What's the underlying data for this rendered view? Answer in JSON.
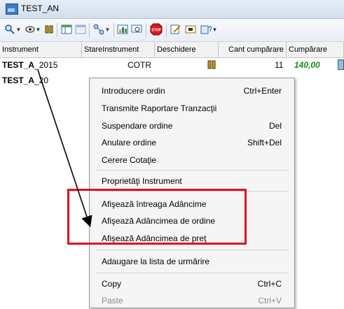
{
  "window": {
    "title": "TEST_AN"
  },
  "toolbar": {
    "icons": [
      "search-icon",
      "eye-icon",
      "binoculars-icon",
      "grid-icon",
      "grid-disabled-icon",
      "nodes-icon",
      "chart-icon",
      "find-icon",
      "stop-icon",
      "edit-icon",
      "info-icon",
      "help-icon"
    ]
  },
  "grid": {
    "columns": [
      "Instrument",
      "StareInstrument",
      "Deschidere",
      "Cant cumpărare",
      "Cumpărare"
    ],
    "rows": [
      {
        "instrument_prefix": "TEST_A",
        "instrument_suffix": "_2015",
        "stare": "COTR",
        "cant": "11",
        "cumparare": "140,00"
      },
      {
        "instrument_prefix": "TEST_A",
        "instrument_suffix": "_20"
      }
    ]
  },
  "menu": {
    "items": [
      {
        "label": "Introducere ordin",
        "shortcut": "Ctrl+Enter"
      },
      {
        "label": "Transmite Raportare Tranzacţii",
        "shortcut": ""
      },
      {
        "label": "Suspendare ordine",
        "shortcut": "Del"
      },
      {
        "label": "Anulare ordine",
        "shortcut": "Shift+Del"
      },
      {
        "label": "Cerere Cotaţie",
        "shortcut": ""
      },
      {
        "label": "Proprietăţi Instrument",
        "shortcut": ""
      },
      {
        "label": "Afişează întreaga Adâncime",
        "shortcut": ""
      },
      {
        "label": "Afişează Adâncimea de ordine",
        "shortcut": ""
      },
      {
        "label": "Afişează Adâncimea de preţ",
        "shortcut": ""
      },
      {
        "label": "Adaugare la lista de urmărire",
        "shortcut": ""
      },
      {
        "label": "Copy",
        "shortcut": "Ctrl+C"
      },
      {
        "label": "Paste",
        "shortcut": "Ctrl+V"
      }
    ]
  },
  "colors": {
    "highlight": "#e3111a",
    "price_green": "#1a8a1a"
  }
}
